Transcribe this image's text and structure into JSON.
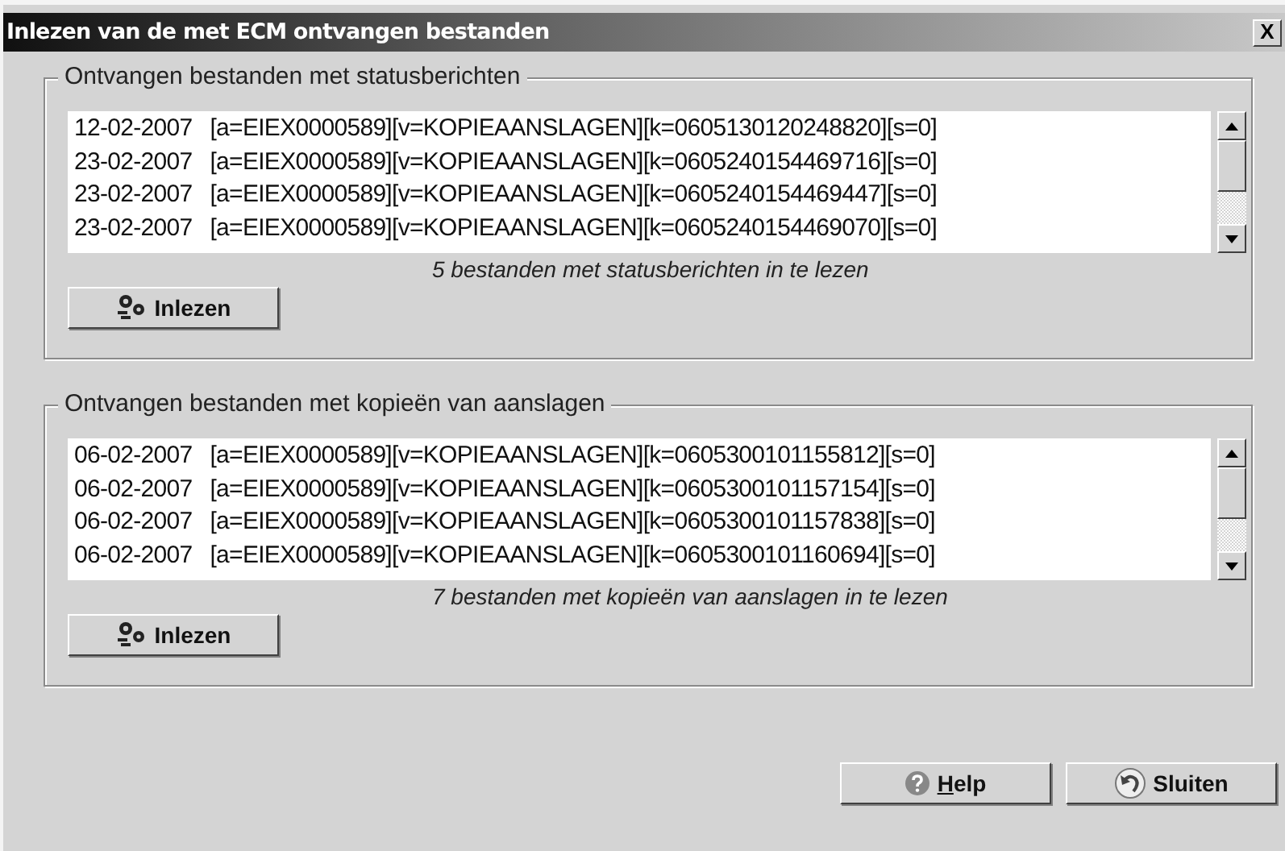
{
  "window": {
    "title": "Inlezen van de met ECM ontvangen bestanden",
    "close": "X"
  },
  "groups": [
    {
      "title": "Ontvangen bestanden met statusberichten",
      "rows": [
        {
          "date": "12-02-2007",
          "name": "[a=EIEX0000589][v=KOPIEAANSLAGEN][k=0605130120248820][s=0]"
        },
        {
          "date": "23-02-2007",
          "name": "[a=EIEX0000589][v=KOPIEAANSLAGEN][k=0605240154469716][s=0]"
        },
        {
          "date": "23-02-2007",
          "name": "[a=EIEX0000589][v=KOPIEAANSLAGEN][k=0605240154469447][s=0]"
        },
        {
          "date": "23-02-2007",
          "name": "[a=EIEX0000589][v=KOPIEAANSLAGEN][k=0605240154469070][s=0]"
        }
      ],
      "count": "5 bestanden met statusberichten in te lezen",
      "button": "Inlezen"
    },
    {
      "title": "Ontvangen bestanden met kopieën van aanslagen",
      "rows": [
        {
          "date": "06-02-2007",
          "name": "[a=EIEX0000589][v=KOPIEAANSLAGEN][k=0605300101155812][s=0]"
        },
        {
          "date": "06-02-2007",
          "name": "[a=EIEX0000589][v=KOPIEAANSLAGEN][k=0605300101157154][s=0]"
        },
        {
          "date": "06-02-2007",
          "name": "[a=EIEX0000589][v=KOPIEAANSLAGEN][k=0605300101157838][s=0]"
        },
        {
          "date": "06-02-2007",
          "name": "[a=EIEX0000589][v=KOPIEAANSLAGEN][k=0605300101160694][s=0]"
        }
      ],
      "count": "7 bestanden met kopieën van aanslagen in te lezen",
      "button": "Inlezen"
    }
  ],
  "buttons": [
    {
      "kind": "help",
      "label": "Help",
      "mnemonic": true
    },
    {
      "kind": "close",
      "label": "Sluiten",
      "mnemonic": false
    }
  ]
}
